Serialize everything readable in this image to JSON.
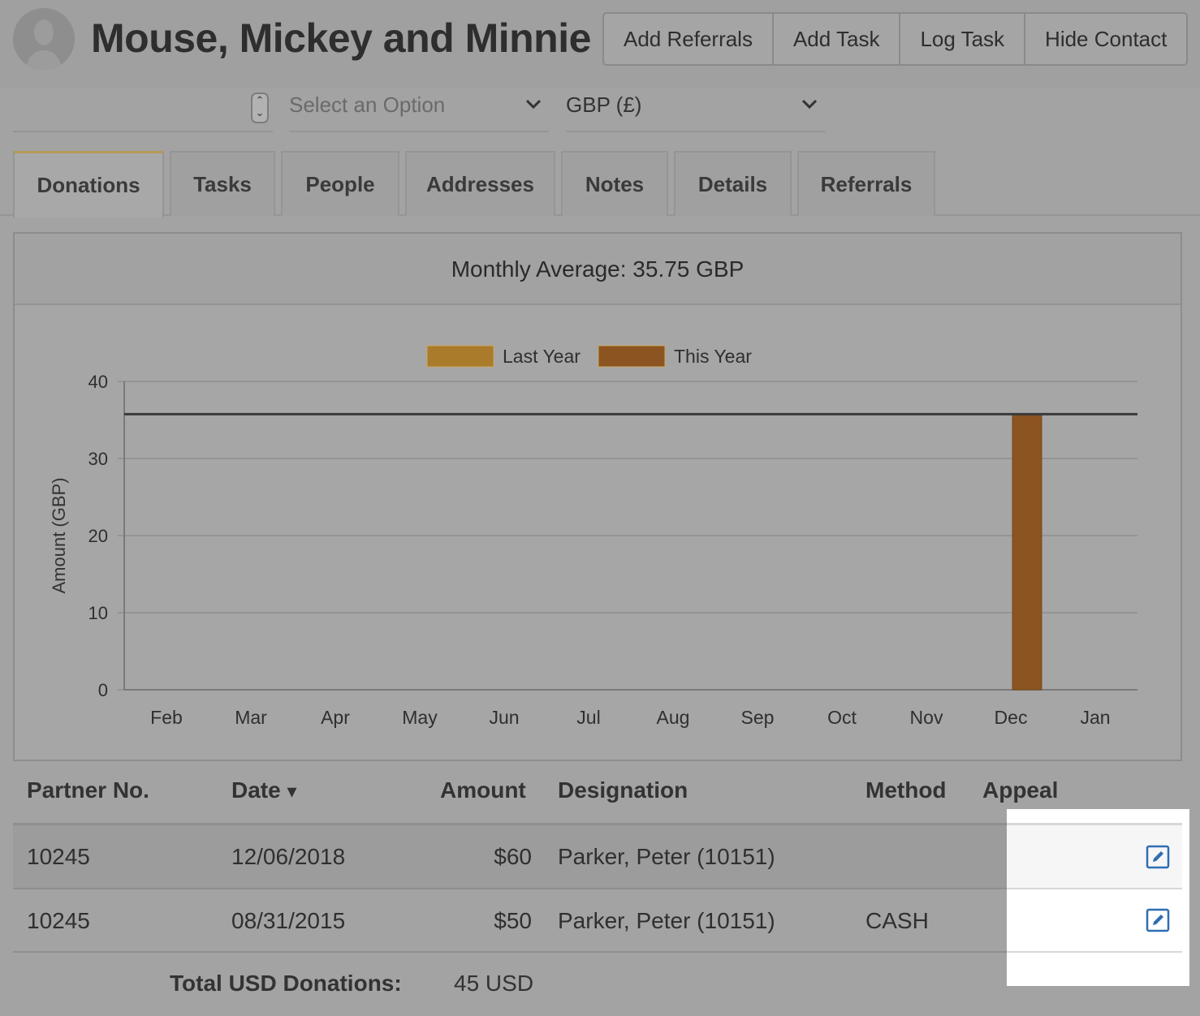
{
  "contact": {
    "name": "Mouse, Mickey and Minnie"
  },
  "actions": [
    "Add Referrals",
    "Add Task",
    "Log Task",
    "Hide Contact"
  ],
  "controls": {
    "option_select": "Select an Option",
    "currency_select": "GBP (£)"
  },
  "tabs": [
    {
      "label": "Donations",
      "active": true
    },
    {
      "label": "Tasks",
      "active": false
    },
    {
      "label": "People",
      "active": false
    },
    {
      "label": "Addresses",
      "active": false
    },
    {
      "label": "Notes",
      "active": false
    },
    {
      "label": "Details",
      "active": false
    },
    {
      "label": "Referrals",
      "active": false
    }
  ],
  "chart_panel": {
    "heading": "Monthly Average: 35.75 GBP"
  },
  "chart_data": {
    "type": "bar",
    "categories": [
      "Feb",
      "Mar",
      "Apr",
      "May",
      "Jun",
      "Jul",
      "Aug",
      "Sep",
      "Oct",
      "Nov",
      "Dec",
      "Jan"
    ],
    "series": [
      {
        "name": "Last Year",
        "color": "#a97b2a",
        "values": [
          0,
          0,
          0,
          0,
          0,
          0,
          0,
          0,
          0,
          0,
          0,
          0
        ]
      },
      {
        "name": "This Year",
        "color": "#8b5420",
        "values": [
          0,
          0,
          0,
          0,
          0,
          0,
          0,
          0,
          0,
          0,
          35.75,
          0
        ]
      }
    ],
    "average_line": 35.75,
    "ylabel": "Amount (GBP)",
    "ylim": [
      0,
      40
    ],
    "yticks": [
      0,
      10,
      20,
      30,
      40
    ],
    "legend_position": "top-center",
    "grid": true
  },
  "table": {
    "headers": {
      "partner": "Partner No.",
      "date": "Date",
      "date_sort": "▾",
      "amount": "Amount",
      "designation": "Designation",
      "method": "Method",
      "appeal": "Appeal"
    },
    "rows": [
      {
        "partner": "10245",
        "date": "12/06/2018",
        "amount": "$60",
        "designation": "Parker, Peter (10151)",
        "method": "",
        "appeal": ""
      },
      {
        "partner": "10245",
        "date": "08/31/2015",
        "amount": "$50",
        "designation": "Parker, Peter (10151)",
        "method": "CASH",
        "appeal": ""
      }
    ],
    "total_label": "Total USD Donations:",
    "total_value": "45 USD"
  },
  "icons": {
    "avatar": "person-silhouette-icon",
    "edit": "edit-pencil-icon",
    "chevron": "chevron-down-icon"
  },
  "colors": {
    "edit_icon": "#2f6db3"
  }
}
